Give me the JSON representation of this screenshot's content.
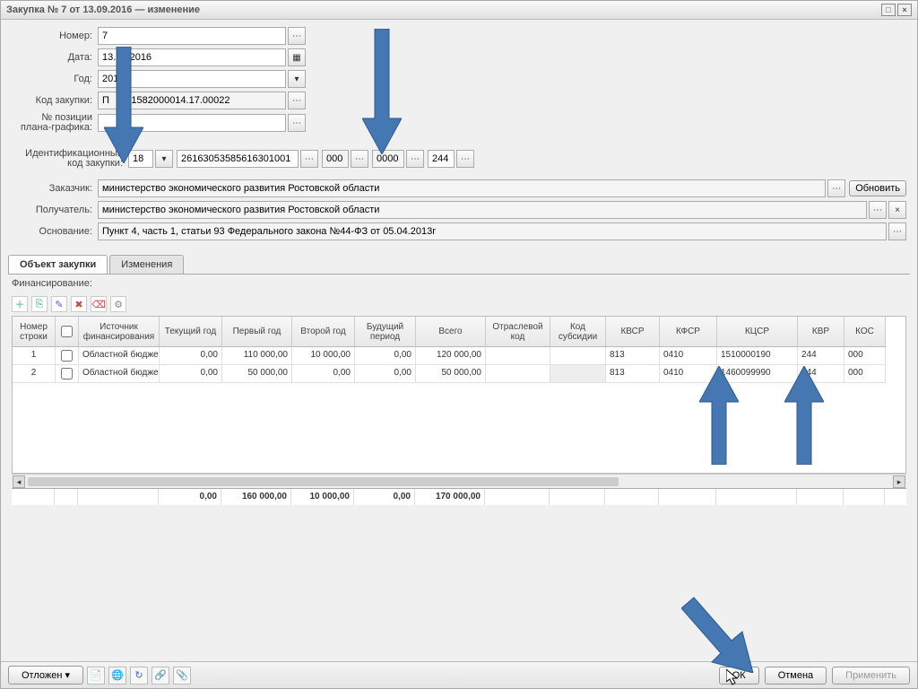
{
  "window": {
    "title": "Закупка № 7 от 13.09.2016 — изменение"
  },
  "form": {
    "number_label": "Номер:",
    "number_value": "7",
    "date_label": "Дата:",
    "date_value": "13.09.2016",
    "year_label": "Год:",
    "year_value": "2016",
    "code_label": "Код закупки:",
    "code_value": "П   3.01582000014.17.00022",
    "planpos_label": "№ позиции плана-графика:",
    "planpos_value": "",
    "ident_label": "Идентификационный код закупки:",
    "ident_p1": "18",
    "ident_p2": "26163053585616301001",
    "ident_p3": "000",
    "ident_p4": "0000",
    "ident_p5": "244",
    "customer_label": "Заказчик:",
    "customer_value": "министерство экономического развития Ростовской области",
    "recipient_label": "Получатель:",
    "recipient_value": "министерство экономического развития Ростовской области",
    "basis_label": "Основание:",
    "basis_value": "Пункт 4, часть 1, статьи 93 Федерального закона №44-ФЗ от 05.04.2013г",
    "refresh_btn": "Обновить"
  },
  "tabs": {
    "t1": "Объект закупки",
    "t2": "Изменения"
  },
  "section": {
    "financing": "Финансирование:"
  },
  "grid": {
    "headers": {
      "row_no": "Номер строки",
      "chk": "",
      "source": "Источник финансирования",
      "cur_year": "Текущий год",
      "year1": "Первый год",
      "year2": "Второй год",
      "future": "Будущий период",
      "total": "Всего",
      "branch": "Отраслевой код",
      "subsidy": "Код субсидии",
      "kvsr": "КВСР",
      "kfsr": "КФСР",
      "kcsr": "КЦСР",
      "kvr": "КВР",
      "kos": "КОС"
    },
    "rows": [
      {
        "no": "1",
        "source": "Областной бюдже",
        "cur": "0,00",
        "y1": "110 000,00",
        "y2": "10 000,00",
        "fut": "0,00",
        "total": "120 000,00",
        "branch": "",
        "sub": "",
        "kvsr": "813",
        "kfsr": "0410",
        "kcsr": "1510000190",
        "kvr": "244",
        "kos": "000"
      },
      {
        "no": "2",
        "source": "Областной бюдже",
        "cur": "0,00",
        "y1": "50 000,00",
        "y2": "0,00",
        "fut": "0,00",
        "total": "50 000,00",
        "branch": "",
        "sub": "",
        "kvsr": "813",
        "kfsr": "0410",
        "kcsr": "1460099990",
        "kvr": "244",
        "kos": "000"
      }
    ],
    "totals": {
      "cur": "0,00",
      "y1": "160 000,00",
      "y2": "10 000,00",
      "fut": "0,00",
      "total": "170 000,00"
    }
  },
  "footer": {
    "status_btn": "Отложен",
    "ok": "ОК",
    "cancel": "Отмена",
    "apply": "Применить"
  }
}
